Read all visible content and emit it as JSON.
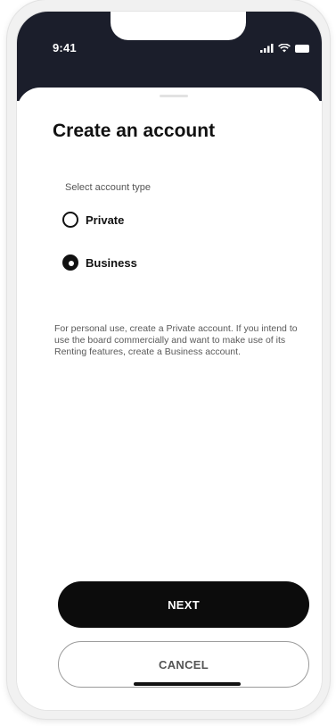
{
  "status_bar": {
    "time": "9:41",
    "icons": [
      "signal-icon",
      "wifi-icon",
      "battery-icon"
    ]
  },
  "screen": {
    "title": "Create an account",
    "select_label": "Select account type",
    "options": [
      {
        "label": "Private",
        "selected": false
      },
      {
        "label": "Business",
        "selected": true
      }
    ],
    "help_text": "For personal use, create a Private account. If you intend to use the board commercially and want to make use of its Renting features, create a Business account."
  },
  "buttons": {
    "next_label": "NEXT",
    "cancel_label": "CANCEL"
  },
  "colors": {
    "header_dark": "#1b1e2b",
    "primary_button": "#0c0c0c",
    "text_primary": "#111111",
    "text_secondary": "#5a5a5a"
  }
}
